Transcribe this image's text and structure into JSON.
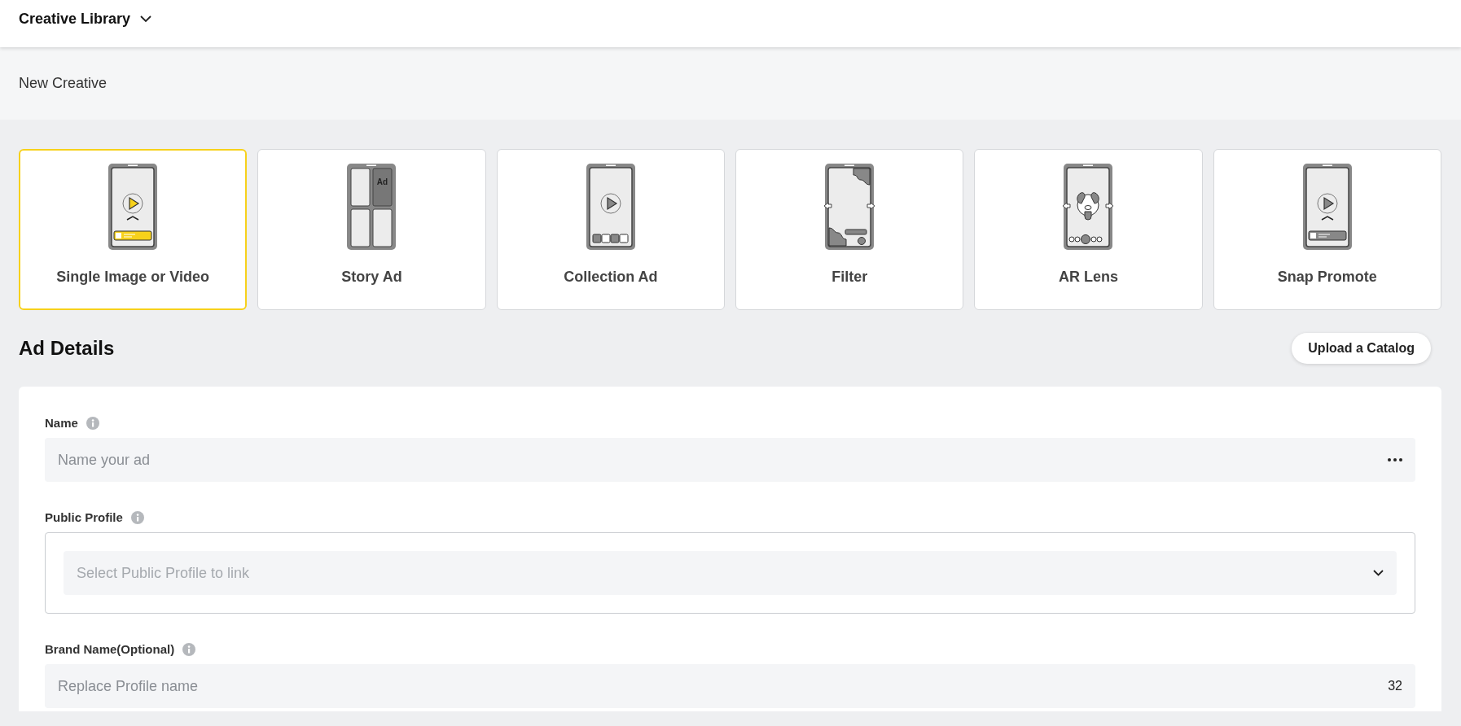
{
  "header": {
    "title": "Creative Library"
  },
  "section": {
    "title": "New Creative"
  },
  "creative_types": [
    {
      "kind": "single",
      "label": "Single Image or Video",
      "selected": true
    },
    {
      "kind": "story",
      "label": "Story Ad",
      "icon_text": "Ad",
      "selected": false
    },
    {
      "kind": "collection",
      "label": "Collection Ad",
      "selected": false
    },
    {
      "kind": "filter",
      "label": "Filter",
      "selected": false
    },
    {
      "kind": "lens",
      "label": "AR Lens",
      "selected": false
    },
    {
      "kind": "promote",
      "label": "Snap Promote",
      "selected": false
    }
  ],
  "ad_details": {
    "title": "Ad Details",
    "upload_button": "Upload a Catalog",
    "fields": [
      {
        "kind": "text",
        "label": "Name",
        "placeholder": "Name your ad"
      },
      {
        "kind": "select",
        "label": "Public Profile",
        "placeholder": "Select Public Profile to link"
      },
      {
        "kind": "counter",
        "label": "Brand Name(Optional)",
        "placeholder": "Replace Profile name",
        "counter": "32"
      }
    ]
  }
}
